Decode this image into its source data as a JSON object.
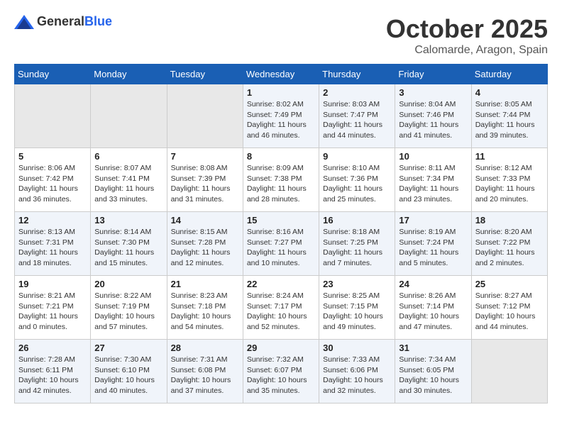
{
  "header": {
    "logo_general": "General",
    "logo_blue": "Blue",
    "month": "October 2025",
    "location": "Calomarde, Aragon, Spain"
  },
  "days_of_week": [
    "Sunday",
    "Monday",
    "Tuesday",
    "Wednesday",
    "Thursday",
    "Friday",
    "Saturday"
  ],
  "weeks": [
    [
      {
        "day": "",
        "lines": []
      },
      {
        "day": "",
        "lines": []
      },
      {
        "day": "",
        "lines": []
      },
      {
        "day": "1",
        "lines": [
          "Sunrise: 8:02 AM",
          "Sunset: 7:49 PM",
          "Daylight: 11 hours",
          "and 46 minutes."
        ]
      },
      {
        "day": "2",
        "lines": [
          "Sunrise: 8:03 AM",
          "Sunset: 7:47 PM",
          "Daylight: 11 hours",
          "and 44 minutes."
        ]
      },
      {
        "day": "3",
        "lines": [
          "Sunrise: 8:04 AM",
          "Sunset: 7:46 PM",
          "Daylight: 11 hours",
          "and 41 minutes."
        ]
      },
      {
        "day": "4",
        "lines": [
          "Sunrise: 8:05 AM",
          "Sunset: 7:44 PM",
          "Daylight: 11 hours",
          "and 39 minutes."
        ]
      }
    ],
    [
      {
        "day": "5",
        "lines": [
          "Sunrise: 8:06 AM",
          "Sunset: 7:42 PM",
          "Daylight: 11 hours",
          "and 36 minutes."
        ]
      },
      {
        "day": "6",
        "lines": [
          "Sunrise: 8:07 AM",
          "Sunset: 7:41 PM",
          "Daylight: 11 hours",
          "and 33 minutes."
        ]
      },
      {
        "day": "7",
        "lines": [
          "Sunrise: 8:08 AM",
          "Sunset: 7:39 PM",
          "Daylight: 11 hours",
          "and 31 minutes."
        ]
      },
      {
        "day": "8",
        "lines": [
          "Sunrise: 8:09 AM",
          "Sunset: 7:38 PM",
          "Daylight: 11 hours",
          "and 28 minutes."
        ]
      },
      {
        "day": "9",
        "lines": [
          "Sunrise: 8:10 AM",
          "Sunset: 7:36 PM",
          "Daylight: 11 hours",
          "and 25 minutes."
        ]
      },
      {
        "day": "10",
        "lines": [
          "Sunrise: 8:11 AM",
          "Sunset: 7:34 PM",
          "Daylight: 11 hours",
          "and 23 minutes."
        ]
      },
      {
        "day": "11",
        "lines": [
          "Sunrise: 8:12 AM",
          "Sunset: 7:33 PM",
          "Daylight: 11 hours",
          "and 20 minutes."
        ]
      }
    ],
    [
      {
        "day": "12",
        "lines": [
          "Sunrise: 8:13 AM",
          "Sunset: 7:31 PM",
          "Daylight: 11 hours",
          "and 18 minutes."
        ]
      },
      {
        "day": "13",
        "lines": [
          "Sunrise: 8:14 AM",
          "Sunset: 7:30 PM",
          "Daylight: 11 hours",
          "and 15 minutes."
        ]
      },
      {
        "day": "14",
        "lines": [
          "Sunrise: 8:15 AM",
          "Sunset: 7:28 PM",
          "Daylight: 11 hours",
          "and 12 minutes."
        ]
      },
      {
        "day": "15",
        "lines": [
          "Sunrise: 8:16 AM",
          "Sunset: 7:27 PM",
          "Daylight: 11 hours",
          "and 10 minutes."
        ]
      },
      {
        "day": "16",
        "lines": [
          "Sunrise: 8:18 AM",
          "Sunset: 7:25 PM",
          "Daylight: 11 hours",
          "and 7 minutes."
        ]
      },
      {
        "day": "17",
        "lines": [
          "Sunrise: 8:19 AM",
          "Sunset: 7:24 PM",
          "Daylight: 11 hours",
          "and 5 minutes."
        ]
      },
      {
        "day": "18",
        "lines": [
          "Sunrise: 8:20 AM",
          "Sunset: 7:22 PM",
          "Daylight: 11 hours",
          "and 2 minutes."
        ]
      }
    ],
    [
      {
        "day": "19",
        "lines": [
          "Sunrise: 8:21 AM",
          "Sunset: 7:21 PM",
          "Daylight: 11 hours",
          "and 0 minutes."
        ]
      },
      {
        "day": "20",
        "lines": [
          "Sunrise: 8:22 AM",
          "Sunset: 7:19 PM",
          "Daylight: 10 hours",
          "and 57 minutes."
        ]
      },
      {
        "day": "21",
        "lines": [
          "Sunrise: 8:23 AM",
          "Sunset: 7:18 PM",
          "Daylight: 10 hours",
          "and 54 minutes."
        ]
      },
      {
        "day": "22",
        "lines": [
          "Sunrise: 8:24 AM",
          "Sunset: 7:17 PM",
          "Daylight: 10 hours",
          "and 52 minutes."
        ]
      },
      {
        "day": "23",
        "lines": [
          "Sunrise: 8:25 AM",
          "Sunset: 7:15 PM",
          "Daylight: 10 hours",
          "and 49 minutes."
        ]
      },
      {
        "day": "24",
        "lines": [
          "Sunrise: 8:26 AM",
          "Sunset: 7:14 PM",
          "Daylight: 10 hours",
          "and 47 minutes."
        ]
      },
      {
        "day": "25",
        "lines": [
          "Sunrise: 8:27 AM",
          "Sunset: 7:12 PM",
          "Daylight: 10 hours",
          "and 44 minutes."
        ]
      }
    ],
    [
      {
        "day": "26",
        "lines": [
          "Sunrise: 7:28 AM",
          "Sunset: 6:11 PM",
          "Daylight: 10 hours",
          "and 42 minutes."
        ]
      },
      {
        "day": "27",
        "lines": [
          "Sunrise: 7:30 AM",
          "Sunset: 6:10 PM",
          "Daylight: 10 hours",
          "and 40 minutes."
        ]
      },
      {
        "day": "28",
        "lines": [
          "Sunrise: 7:31 AM",
          "Sunset: 6:08 PM",
          "Daylight: 10 hours",
          "and 37 minutes."
        ]
      },
      {
        "day": "29",
        "lines": [
          "Sunrise: 7:32 AM",
          "Sunset: 6:07 PM",
          "Daylight: 10 hours",
          "and 35 minutes."
        ]
      },
      {
        "day": "30",
        "lines": [
          "Sunrise: 7:33 AM",
          "Sunset: 6:06 PM",
          "Daylight: 10 hours",
          "and 32 minutes."
        ]
      },
      {
        "day": "31",
        "lines": [
          "Sunrise: 7:34 AM",
          "Sunset: 6:05 PM",
          "Daylight: 10 hours",
          "and 30 minutes."
        ]
      },
      {
        "day": "",
        "lines": []
      }
    ]
  ]
}
